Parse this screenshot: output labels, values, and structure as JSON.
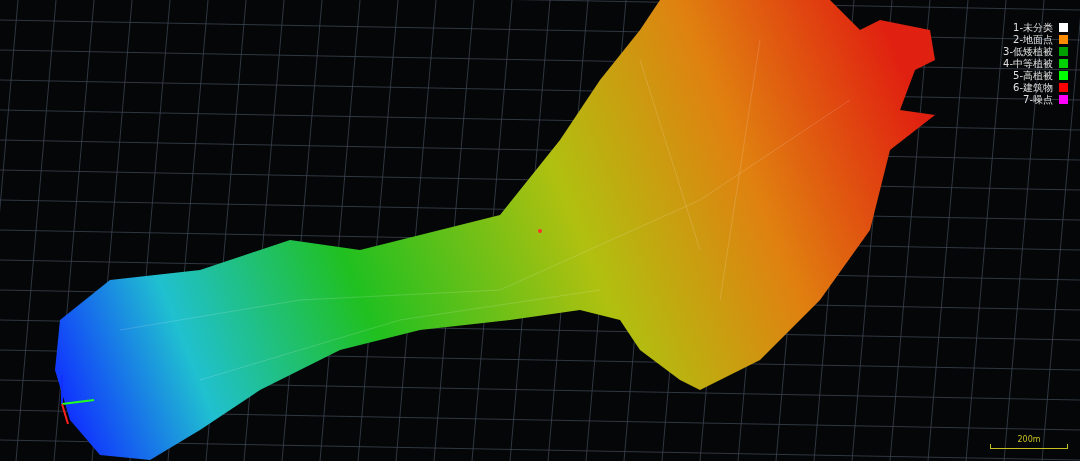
{
  "legend": [
    {
      "label": "1-未分类",
      "color": "#ffffff"
    },
    {
      "label": "2-地面点",
      "color": "#ff8c00"
    },
    {
      "label": "3-低矮植被",
      "color": "#00a000"
    },
    {
      "label": "4-中等植被",
      "color": "#00d000"
    },
    {
      "label": "5-高植被",
      "color": "#00ff00"
    },
    {
      "label": "6-建筑物",
      "color": "#ff0000"
    },
    {
      "label": "7-噪点",
      "color": "#ff00ff"
    }
  ],
  "scale_bar": {
    "label": "200m"
  }
}
